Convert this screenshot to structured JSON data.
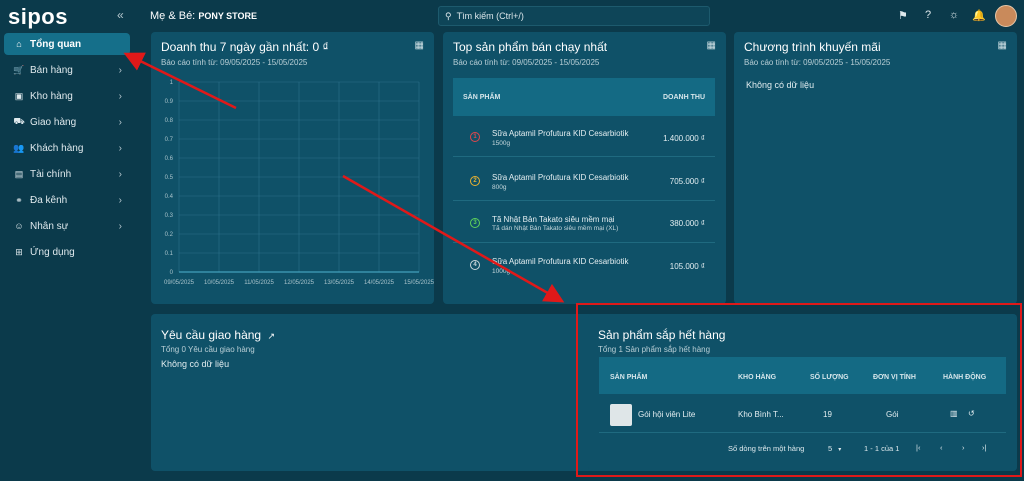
{
  "app": {
    "logo": "sipos",
    "collapse_icon": "double-chevron-left-icon"
  },
  "sidebar": {
    "items": [
      {
        "label": "Tổng quan",
        "icon": "home-icon",
        "active": true
      },
      {
        "label": "Bán hàng",
        "icon": "cart-icon"
      },
      {
        "label": "Kho hàng",
        "icon": "box-icon"
      },
      {
        "label": "Giao hàng",
        "icon": "truck-icon"
      },
      {
        "label": "Khách hàng",
        "icon": "users-icon"
      },
      {
        "label": "Tài chính",
        "icon": "finance-icon"
      },
      {
        "label": "Đa kênh",
        "icon": "multichannel-icon"
      },
      {
        "label": "Nhân sự",
        "icon": "staff-icon"
      },
      {
        "label": "Ứng dụng",
        "icon": "apps-icon"
      }
    ]
  },
  "header": {
    "store_prefix": "Mẹ & Bé:",
    "store_name": "PONY STORE",
    "search_placeholder": "Tìm kiếm (Ctrl+/)"
  },
  "revenue": {
    "title": "Doanh thu 7 ngày gần nhất: 0 ₫",
    "sub": "Báo cáo tính từ: 09/05/2025 - 15/05/2025"
  },
  "chart_data": {
    "type": "line",
    "x": [
      "09/05/2025",
      "10/05/2025",
      "11/05/2025",
      "12/05/2025",
      "13/05/2025",
      "14/05/2025",
      "15/05/2025"
    ],
    "series": [
      {
        "values": [
          0,
          0,
          0,
          0,
          0,
          0,
          0
        ]
      }
    ],
    "yticks": [
      "1",
      "0.9",
      "0.8",
      "0.7",
      "0.6",
      "0.5",
      "0.4",
      "0.3",
      "0.2",
      "0.1",
      "0"
    ],
    "ylim": [
      0,
      1
    ],
    "grid": true
  },
  "top_products": {
    "title": "Top sản phẩm bán chạy nhất",
    "sub": "Báo cáo tính từ: 09/05/2025 - 15/05/2025",
    "col_product": "SẢN PHẨM",
    "col_revenue": "DOANH THU",
    "rows": [
      {
        "rank": "1",
        "name": "Sữa Aptamil Profutura KID Cesarbiotik",
        "variant": "1500g",
        "revenue": "1.400.000 ₫",
        "color": "#e0474c"
      },
      {
        "rank": "2",
        "name": "Sữa Aptamil Profutura KID Cesarbiotik",
        "variant": "800g",
        "revenue": "705.000 ₫",
        "color": "#e8b231"
      },
      {
        "rank": "3",
        "name": "Tã Nhật Bản Takato siêu mềm mại",
        "variant": "Tã dán Nhật Bản Takato siêu mềm mại (XL)",
        "revenue": "380.000 ₫",
        "color": "#5fd15b"
      },
      {
        "rank": "4",
        "name": "Sữa Aptamil Profutura KID Cesarbiotik",
        "variant": "1000g",
        "revenue": "105.000 ₫",
        "color": "#c9d6da"
      }
    ]
  },
  "promotions": {
    "title": "Chương trình khuyến mãi",
    "sub": "Báo cáo tính từ: 09/05/2025 - 15/05/2025",
    "empty": "Không có dữ liệu"
  },
  "delivery": {
    "title": "Yêu cầu giao hàng",
    "sub": "Tổng 0 Yêu cầu giao hàng",
    "empty": "Không có dữ liệu"
  },
  "low_stock": {
    "title": "Sản phẩm sắp hết hàng",
    "sub": "Tổng 1 Sản phẩm sắp hết hàng",
    "cols": [
      "SẢN PHẨM",
      "KHO HÀNG",
      "SỐ LƯỢNG",
      "ĐƠN VỊ TÍNH",
      "HÀNH ĐỘNG"
    ],
    "row": {
      "name": "Gói hội viên Lite",
      "warehouse": "Kho Bình T...",
      "qty": "19",
      "unit": "Gói"
    },
    "rows_per_page_label": "Số dòng trên một hàng",
    "rows_per_page": "5",
    "range": "1 - 1 của 1"
  },
  "colors": {
    "annotation": "#e01919",
    "card": "#0f5168",
    "background": "#0b3a4b"
  }
}
